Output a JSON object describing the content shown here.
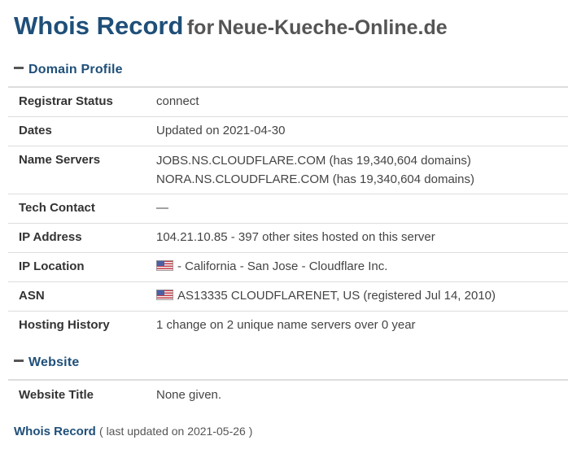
{
  "header": {
    "title_main": "Whois Record",
    "title_for": "for",
    "domain": "Neue-Kueche-Online.de"
  },
  "domain_profile": {
    "section_label": "Domain Profile",
    "rows": {
      "registrar_status": {
        "label": "Registrar Status",
        "value": "connect"
      },
      "dates": {
        "label": "Dates",
        "value": "Updated on 2021-04-30"
      },
      "name_servers": {
        "label": "Name Servers",
        "values": [
          "JOBS.NS.CLOUDFLARE.COM (has 19,340,604 domains)",
          "NORA.NS.CLOUDFLARE.COM (has 19,340,604 domains)"
        ]
      },
      "tech_contact": {
        "label": "Tech Contact",
        "value": "—"
      },
      "ip_address": {
        "label": "IP Address",
        "value": "104.21.10.85 - 397 other sites hosted on this server"
      },
      "ip_location": {
        "label": "IP Location",
        "value": "- California - San Jose - Cloudflare Inc.",
        "flag_icon": "us-flag-icon"
      },
      "asn": {
        "label": "ASN",
        "value": "AS13335 CLOUDFLARENET, US (registered Jul 14, 2010)",
        "flag_icon": "us-flag-icon"
      },
      "hosting_history": {
        "label": "Hosting History",
        "value": "1 change on 2 unique name servers over 0 year"
      }
    }
  },
  "website": {
    "section_label": "Website",
    "rows": {
      "website_title": {
        "label": "Website Title",
        "value": "None given."
      }
    }
  },
  "footer": {
    "link_label": "Whois Record",
    "updated_text": "( last updated on 2021-05-26 )"
  },
  "colors": {
    "heading_blue": "#1f4f79",
    "text_gray": "#444444",
    "border": "#dddddd"
  }
}
